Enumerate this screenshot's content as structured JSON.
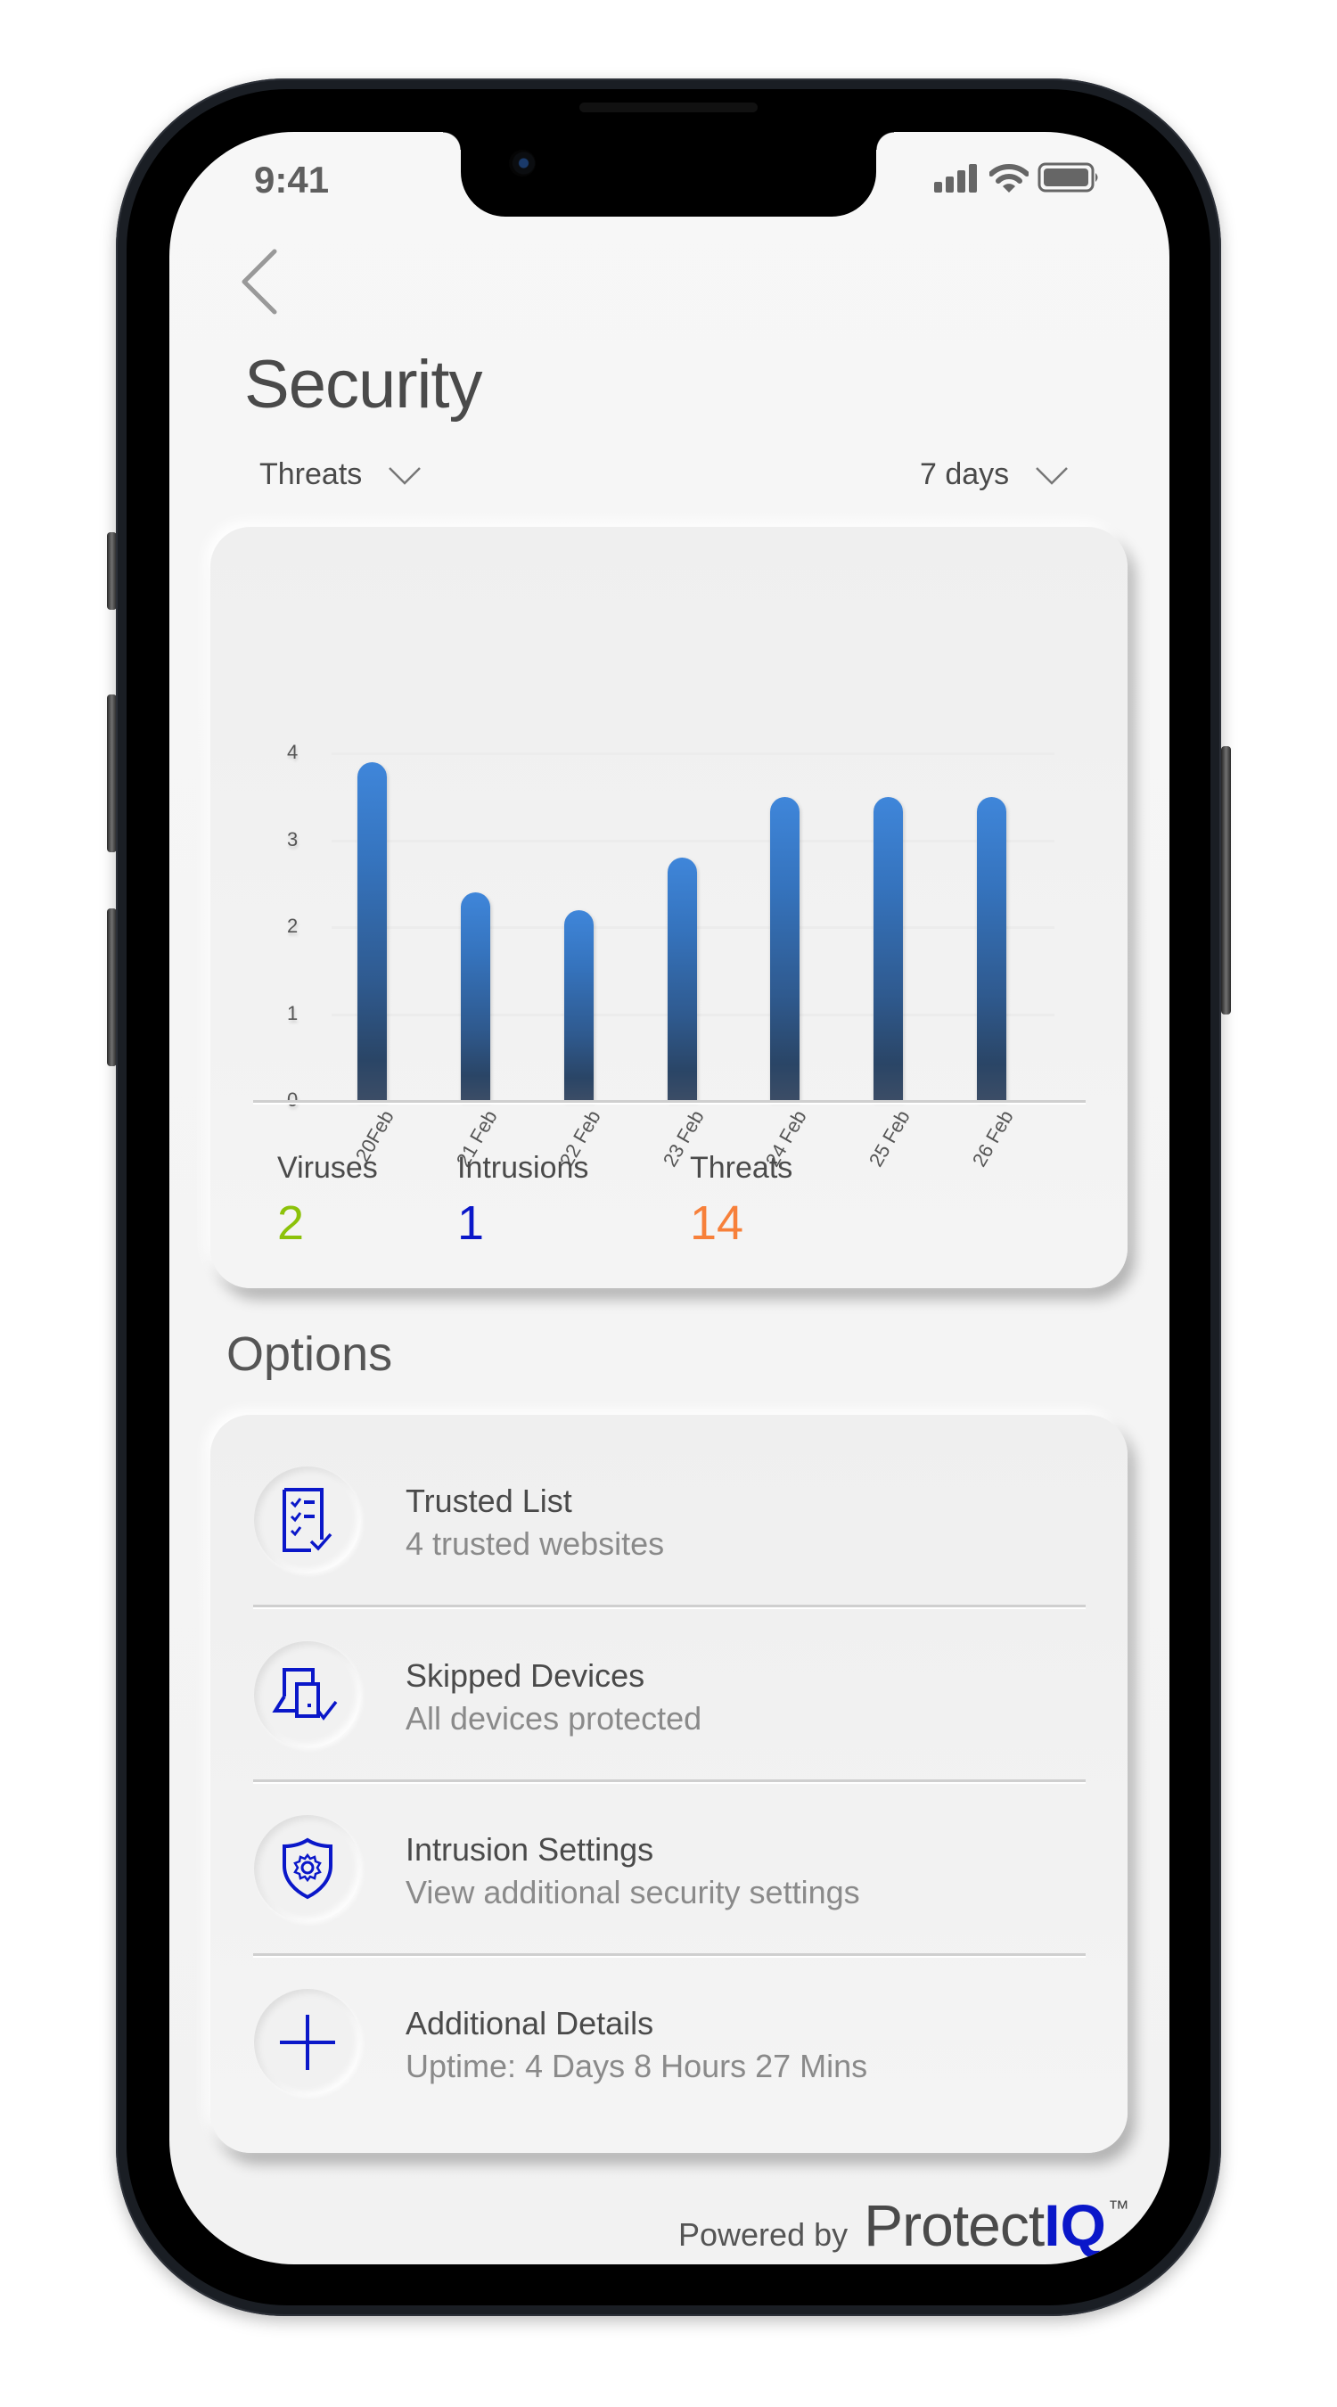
{
  "status_bar": {
    "time": "9:41",
    "icons": [
      "cellular-signal-icon",
      "wifi-icon",
      "battery-icon"
    ]
  },
  "header": {
    "back_icon": "chevron-left-icon",
    "title": "Security"
  },
  "filters": {
    "metric": {
      "selected": "Threats",
      "icon": "chevron-down-icon"
    },
    "range": {
      "selected": "7 days",
      "icon": "chevron-down-icon"
    }
  },
  "chart_data": {
    "type": "bar",
    "title": "",
    "xlabel": "",
    "ylabel": "",
    "categories": [
      "20Feb",
      "21 Feb",
      "22 Feb",
      "23 Feb",
      "24 Feb",
      "25 Feb",
      "26 Feb"
    ],
    "values": [
      3.9,
      2.4,
      2.2,
      2.8,
      3.5,
      3.5,
      3.5
    ],
    "ylim": [
      0,
      4
    ],
    "yticks": [
      "0",
      "1",
      "2",
      "3",
      "4"
    ],
    "grid": true,
    "legend": "none",
    "bar_color": "#3573bd"
  },
  "summary": {
    "stats": [
      {
        "label": "Viruses",
        "value": "2",
        "color": "#8cc20a"
      },
      {
        "label": "Intrusions",
        "value": "1",
        "color": "#0a17c9"
      },
      {
        "label": "Threats",
        "value": "14",
        "color": "#f7803a"
      }
    ]
  },
  "options": {
    "heading": "Options",
    "items": [
      {
        "title": "Trusted List",
        "subtitle": "4 trusted websites",
        "icon": "checklist-icon"
      },
      {
        "title": "Skipped Devices",
        "subtitle": "All devices protected",
        "icon": "devices-check-icon"
      },
      {
        "title": "Intrusion Settings",
        "subtitle": "View additional security settings",
        "icon": "shield-gear-icon"
      },
      {
        "title": "Additional Details",
        "subtitle": "Uptime: 4 Days 8 Hours 27 Mins",
        "icon": "plus-icon"
      }
    ]
  },
  "footer": {
    "powered_by": "Powered by",
    "brand_main": "Protect",
    "brand_accent": "IQ",
    "trademark": "™"
  },
  "colors": {
    "accent_blue": "#0a17c9",
    "text_primary": "#4a4a4a",
    "text_secondary": "#8a8a8a",
    "screen_bg": "#f5f5f5"
  }
}
